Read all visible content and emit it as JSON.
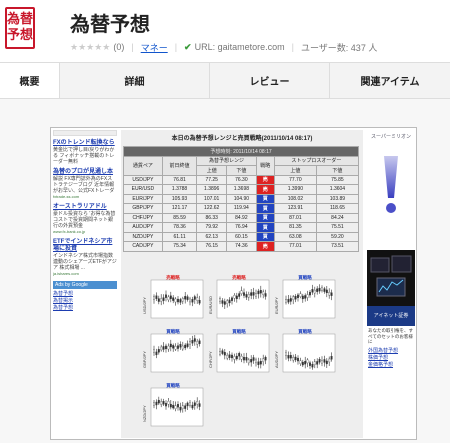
{
  "header": {
    "logo_top": "為替",
    "logo_bottom": "予想",
    "title": "為替予想",
    "rating_count": "(0)",
    "category_link": "マネー",
    "url_label": "URL: gaitametore.com",
    "users": "ユーザー数: 437 人"
  },
  "tabs": [
    {
      "label": "概要"
    },
    {
      "label": "詳細"
    },
    {
      "label": "レビュー"
    },
    {
      "label": "関連アイテム"
    }
  ],
  "screenshot": {
    "left_ads": [
      {
        "head": "FXのトレンド転換なら",
        "body": "黄金比で押し目/戻りがわかる フィボナッチ搭載のトレーダー無料",
        "url": ""
      },
      {
        "head": "為替のプロが見通し本",
        "body": "解説 FX専門誌外為のFXストラテジーブログ 近年情報がお早い、公式FXトレーダ",
        "url": "fxtrade-ss.com"
      },
      {
        "head": "オーストラリアドル",
        "body": "豪ドル投資なら 'お得な為替 コストで投資期間ネット銀行の外貨預金",
        "url": "www.fx-bank.co.jp"
      },
      {
        "head": "ETFでインドネシア市場に投資",
        "body": "インドネシア株式市場指数連動のシェアーズETFがアジア 株式相場 ...",
        "url": "ja.ishares.com"
      }
    ],
    "ad_link_bar": "Ads by Google",
    "left_nav": [
      "為替予想",
      "為替掲示",
      "為替予想"
    ],
    "heading": "本日の為替予想レンジと売買戦略(2011/10/14 08:17)",
    "table_date": "予想時刻: 2011/10/14 08:17",
    "table_head1": [
      "通貨ペア",
      "前日終値",
      "為替予想レンジ",
      "戦略",
      "ストップロスオーダー"
    ],
    "table_head2": [
      "上値",
      "下値",
      "上値",
      "下値"
    ],
    "rows": [
      {
        "pair": "USD/JPY",
        "close": "76.81",
        "hi": "77.25",
        "lo": "76.30",
        "sig": "売",
        "color": "#d22",
        "sl_hi": "77.70",
        "sl_lo": "75.85"
      },
      {
        "pair": "EUR/USD",
        "close": "1.3788",
        "hi": "1.3896",
        "lo": "1.3698",
        "sig": "売",
        "color": "#d22",
        "sl_hi": "1.3990",
        "sl_lo": "1.3604"
      },
      {
        "pair": "EUR/JPY",
        "close": "105.93",
        "hi": "107.01",
        "lo": "104.90",
        "sig": "買",
        "color": "#2244c0",
        "sl_hi": "108.02",
        "sl_lo": "103.89"
      },
      {
        "pair": "GBP/JPY",
        "close": "121.17",
        "hi": "122.62",
        "lo": "119.94",
        "sig": "買",
        "color": "#2244c0",
        "sl_hi": "123.91",
        "sl_lo": "118.65"
      },
      {
        "pair": "CHF/JPY",
        "close": "85.59",
        "hi": "86.33",
        "lo": "84.92",
        "sig": "買",
        "color": "#2244c0",
        "sl_hi": "87.01",
        "sl_lo": "84.24"
      },
      {
        "pair": "AUD/JPY",
        "close": "78.36",
        "hi": "79.92",
        "lo": "76.94",
        "sig": "買",
        "color": "#2244c0",
        "sl_hi": "81.35",
        "sl_lo": "75.51"
      },
      {
        "pair": "NZD/JPY",
        "close": "61.11",
        "hi": "62.13",
        "lo": "60.15",
        "sig": "買",
        "color": "#2244c0",
        "sl_hi": "63.08",
        "sl_lo": "59.20"
      },
      {
        "pair": "CAD/JPY",
        "close": "75.34",
        "hi": "76.15",
        "lo": "74.36",
        "sig": "売",
        "color": "#d22",
        "sl_hi": "77.01",
        "sl_lo": "73.51"
      }
    ],
    "charts": [
      {
        "pair": "USD/JPY",
        "tag": "売戦略",
        "color": "#d22"
      },
      {
        "pair": "EUR/USD",
        "tag": "売戦略",
        "color": "#d22"
      },
      {
        "pair": "EUR/JPY",
        "tag": "買戦略",
        "color": "#2244c0"
      },
      {
        "pair": "GBP/JPY",
        "tag": "買戦略",
        "color": "#2244c0"
      },
      {
        "pair": "CHF/JPY",
        "tag": "買戦略",
        "color": "#2244c0"
      },
      {
        "pair": "AUD/JPY",
        "tag": "買戦略",
        "color": "#2244c0"
      },
      {
        "pair": "NZD/JPY",
        "tag": "買戦略",
        "color": "#2244c0"
      }
    ],
    "right_top_label": "スーパーミリオン",
    "right_blue": "アイネット証券",
    "right_text": "あなたの取引権を、すべてのセットのお客様に",
    "right_links": [
      "外国為替予想",
      "株価予想",
      "金価格予想"
    ]
  }
}
